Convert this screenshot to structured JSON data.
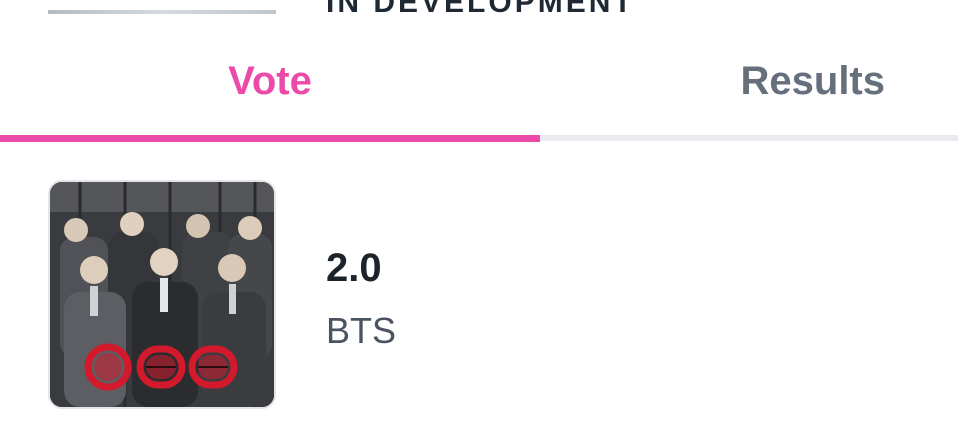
{
  "header": {
    "cut_off_title": "IN DEVELOPMENT"
  },
  "tabs": [
    {
      "label": "Vote",
      "active": true
    },
    {
      "label": "Results",
      "active": false
    }
  ],
  "colors": {
    "accent": "#ec4aa8",
    "inactive_tab": "#66707c",
    "title": "#1d232b",
    "subtitle": "#4a5361"
  },
  "album": {
    "title": "2.0",
    "artist": "BTS",
    "cover_icon": "album-cover-image"
  }
}
